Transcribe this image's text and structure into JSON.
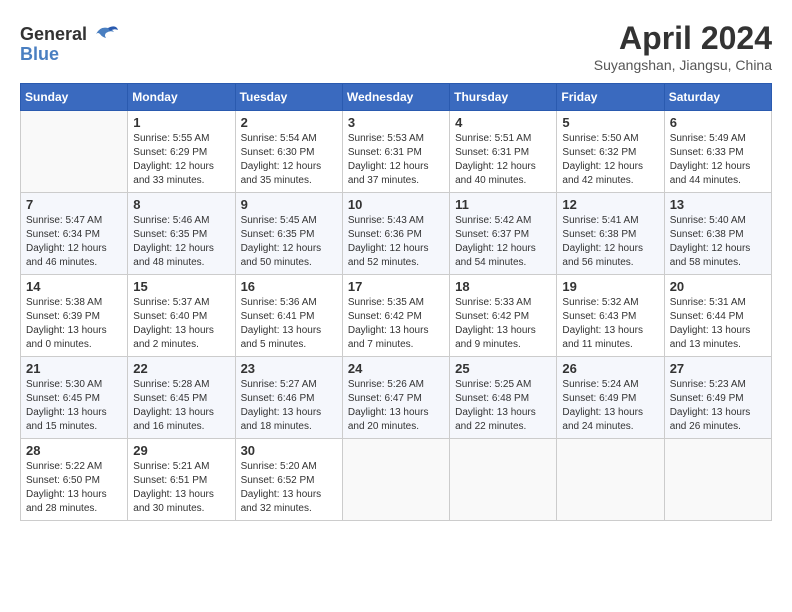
{
  "header": {
    "logo_general": "General",
    "logo_blue": "Blue",
    "title": "April 2024",
    "subtitle": "Suyangshan, Jiangsu, China"
  },
  "weekdays": [
    "Sunday",
    "Monday",
    "Tuesday",
    "Wednesday",
    "Thursday",
    "Friday",
    "Saturday"
  ],
  "weeks": [
    [
      {
        "day": "",
        "info": ""
      },
      {
        "day": "1",
        "info": "Sunrise: 5:55 AM\nSunset: 6:29 PM\nDaylight: 12 hours\nand 33 minutes."
      },
      {
        "day": "2",
        "info": "Sunrise: 5:54 AM\nSunset: 6:30 PM\nDaylight: 12 hours\nand 35 minutes."
      },
      {
        "day": "3",
        "info": "Sunrise: 5:53 AM\nSunset: 6:31 PM\nDaylight: 12 hours\nand 37 minutes."
      },
      {
        "day": "4",
        "info": "Sunrise: 5:51 AM\nSunset: 6:31 PM\nDaylight: 12 hours\nand 40 minutes."
      },
      {
        "day": "5",
        "info": "Sunrise: 5:50 AM\nSunset: 6:32 PM\nDaylight: 12 hours\nand 42 minutes."
      },
      {
        "day": "6",
        "info": "Sunrise: 5:49 AM\nSunset: 6:33 PM\nDaylight: 12 hours\nand 44 minutes."
      }
    ],
    [
      {
        "day": "7",
        "info": "Sunrise: 5:47 AM\nSunset: 6:34 PM\nDaylight: 12 hours\nand 46 minutes."
      },
      {
        "day": "8",
        "info": "Sunrise: 5:46 AM\nSunset: 6:35 PM\nDaylight: 12 hours\nand 48 minutes."
      },
      {
        "day": "9",
        "info": "Sunrise: 5:45 AM\nSunset: 6:35 PM\nDaylight: 12 hours\nand 50 minutes."
      },
      {
        "day": "10",
        "info": "Sunrise: 5:43 AM\nSunset: 6:36 PM\nDaylight: 12 hours\nand 52 minutes."
      },
      {
        "day": "11",
        "info": "Sunrise: 5:42 AM\nSunset: 6:37 PM\nDaylight: 12 hours\nand 54 minutes."
      },
      {
        "day": "12",
        "info": "Sunrise: 5:41 AM\nSunset: 6:38 PM\nDaylight: 12 hours\nand 56 minutes."
      },
      {
        "day": "13",
        "info": "Sunrise: 5:40 AM\nSunset: 6:38 PM\nDaylight: 12 hours\nand 58 minutes."
      }
    ],
    [
      {
        "day": "14",
        "info": "Sunrise: 5:38 AM\nSunset: 6:39 PM\nDaylight: 13 hours\nand 0 minutes."
      },
      {
        "day": "15",
        "info": "Sunrise: 5:37 AM\nSunset: 6:40 PM\nDaylight: 13 hours\nand 2 minutes."
      },
      {
        "day": "16",
        "info": "Sunrise: 5:36 AM\nSunset: 6:41 PM\nDaylight: 13 hours\nand 5 minutes."
      },
      {
        "day": "17",
        "info": "Sunrise: 5:35 AM\nSunset: 6:42 PM\nDaylight: 13 hours\nand 7 minutes."
      },
      {
        "day": "18",
        "info": "Sunrise: 5:33 AM\nSunset: 6:42 PM\nDaylight: 13 hours\nand 9 minutes."
      },
      {
        "day": "19",
        "info": "Sunrise: 5:32 AM\nSunset: 6:43 PM\nDaylight: 13 hours\nand 11 minutes."
      },
      {
        "day": "20",
        "info": "Sunrise: 5:31 AM\nSunset: 6:44 PM\nDaylight: 13 hours\nand 13 minutes."
      }
    ],
    [
      {
        "day": "21",
        "info": "Sunrise: 5:30 AM\nSunset: 6:45 PM\nDaylight: 13 hours\nand 15 minutes."
      },
      {
        "day": "22",
        "info": "Sunrise: 5:28 AM\nSunset: 6:45 PM\nDaylight: 13 hours\nand 16 minutes."
      },
      {
        "day": "23",
        "info": "Sunrise: 5:27 AM\nSunset: 6:46 PM\nDaylight: 13 hours\nand 18 minutes."
      },
      {
        "day": "24",
        "info": "Sunrise: 5:26 AM\nSunset: 6:47 PM\nDaylight: 13 hours\nand 20 minutes."
      },
      {
        "day": "25",
        "info": "Sunrise: 5:25 AM\nSunset: 6:48 PM\nDaylight: 13 hours\nand 22 minutes."
      },
      {
        "day": "26",
        "info": "Sunrise: 5:24 AM\nSunset: 6:49 PM\nDaylight: 13 hours\nand 24 minutes."
      },
      {
        "day": "27",
        "info": "Sunrise: 5:23 AM\nSunset: 6:49 PM\nDaylight: 13 hours\nand 26 minutes."
      }
    ],
    [
      {
        "day": "28",
        "info": "Sunrise: 5:22 AM\nSunset: 6:50 PM\nDaylight: 13 hours\nand 28 minutes."
      },
      {
        "day": "29",
        "info": "Sunrise: 5:21 AM\nSunset: 6:51 PM\nDaylight: 13 hours\nand 30 minutes."
      },
      {
        "day": "30",
        "info": "Sunrise: 5:20 AM\nSunset: 6:52 PM\nDaylight: 13 hours\nand 32 minutes."
      },
      {
        "day": "",
        "info": ""
      },
      {
        "day": "",
        "info": ""
      },
      {
        "day": "",
        "info": ""
      },
      {
        "day": "",
        "info": ""
      }
    ]
  ]
}
